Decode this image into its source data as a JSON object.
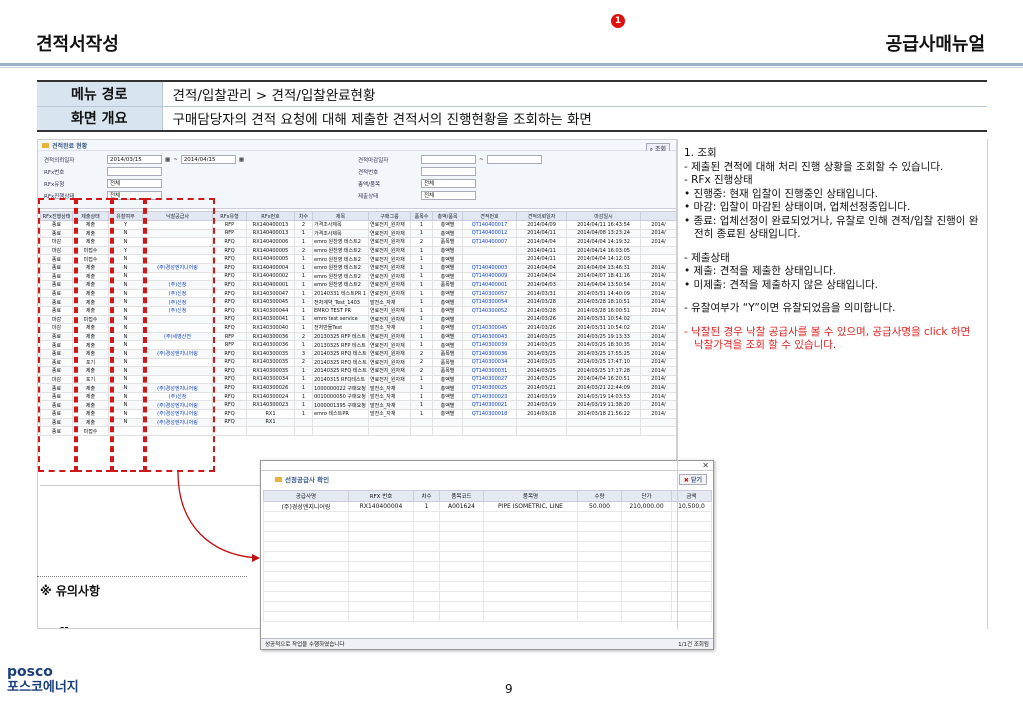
{
  "header": {
    "title_left": "견적서작성",
    "title_right": "공급사매뉴얼"
  },
  "info": [
    {
      "key": "메뉴 경로",
      "value": "견적/입찰관리 > 견적/입찰완료현황"
    },
    {
      "key": "화면 개요",
      "value": "구매담당자의 견적 요청에 대해 제출한 견적서의 진행현황을 조회하는 화면"
    }
  ],
  "screen": {
    "title": "견적완료 현황",
    "search_button": "조회",
    "badge": "1",
    "fields": {
      "f1_label": "견적의뢰일자",
      "f1_from": "2014/03/15",
      "f1_to": "2014/04/15",
      "f2_label": "RFx번호",
      "f3_label": "RFx유형",
      "f3_value": "전체",
      "f4_label": "RFx진행상태",
      "f4_value": "전체",
      "f5_label": "견적마감일자",
      "f6_label": "견적번호",
      "f7_label": "총액/품목",
      "f7_value": "전체",
      "f8_label": "제출상태",
      "f8_value": "전체"
    },
    "columns": [
      "RFx진행상태",
      "제출상태",
      "유찰여부",
      "낙찰공급사",
      "RFx유형",
      "RFx번호",
      "차수",
      "제목",
      "구매그룹",
      "품목수",
      "총액/품목",
      "견적번호",
      "견적의뢰일자",
      "마감일시",
      ""
    ],
    "rows": [
      [
        "종료",
        "제출",
        "Y",
        "",
        "RFP",
        "RX140400013",
        "2",
        "가격조사제목",
        "연료전지_원자재",
        "1",
        "총액별",
        "QT140400017",
        "2014/04/09",
        "2014/04/11 16:43:54",
        "2014/"
      ],
      [
        "종료",
        "제출",
        "N",
        "",
        "RFP",
        "RX140400013",
        "1",
        "가격조사제목",
        "연료전지_원자재",
        "1",
        "총액별",
        "QT140400012",
        "2014/04/11",
        "2014/04/08 13:23:24",
        "2014/"
      ],
      [
        "마감",
        "제출",
        "N",
        "",
        "RFQ",
        "RX140400006",
        "1",
        "emro 원찬영 테스트2",
        "연료전지_원자재",
        "2",
        "품목별",
        "QT140400007",
        "2014/04/04",
        "2014/04/04 14:19:32",
        "2014/"
      ],
      [
        "마감",
        "미접수",
        "Y",
        "",
        "RFQ",
        "RX140400005",
        "2",
        "emro 원찬영 테스트2",
        "연료전지_원자재",
        "1",
        "총액별",
        "",
        "2014/04/11",
        "2014/04/14 16:03:05",
        ""
      ],
      [
        "종료",
        "미접수",
        "N",
        "",
        "RFQ",
        "RX140400005",
        "1",
        "emro 원찬영 테스트2",
        "연료전지_원자재",
        "1",
        "총액별",
        "",
        "2014/04/11",
        "2014/04/04 14:12:03",
        ""
      ],
      [
        "종료",
        "제출",
        "N",
        "(주)경성엔지니어링",
        "RFQ",
        "RX140400004",
        "1",
        "emro 원찬영 테스트2",
        "연료전지_원자재",
        "1",
        "총액별",
        "QT140400003",
        "2014/04/04",
        "2014/04/04 13:46:31",
        "2014/"
      ],
      [
        "종료",
        "제출",
        "N",
        "",
        "RFQ",
        "RX140400002",
        "1",
        "emro 원찬영 테스트2",
        "연료전지_원자재",
        "1",
        "총액별",
        "QT140400009",
        "2014/04/04",
        "2014/04/07 18:41:16",
        "2014/"
      ],
      [
        "종료",
        "제출",
        "N",
        "(주)신정",
        "RFQ",
        "RX140400001",
        "1",
        "emro 원찬영 테스트2",
        "연료전지_원자재",
        "1",
        "품목별",
        "QT140400001",
        "2014/04/03",
        "2014/04/04 13:50:54",
        "2014/"
      ],
      [
        "종료",
        "제출",
        "N",
        "(주)신정",
        "RFQ",
        "RX140300047",
        "1",
        "20140331 테스트PR 1",
        "연료전지_원자재",
        "1",
        "총액별",
        "QT140300057",
        "2014/03/31",
        "2014/03/31 14:40:09",
        "2014/"
      ],
      [
        "종료",
        "제출",
        "N",
        "(주)신정",
        "RFQ",
        "RX140300045",
        "1",
        "전처계약_Test_1403",
        "발전소_자재",
        "1",
        "총액별",
        "QT140300054",
        "2014/03/28",
        "2014/03/28 18:10:51",
        "2014/"
      ],
      [
        "종료",
        "제출",
        "N",
        "(주)신정",
        "RFQ",
        "RX140300044",
        "1",
        "EMRO TEST PR",
        "연료전지_원자재",
        "1",
        "총액별",
        "QT140300052",
        "2014/03/28",
        "2014/03/28 16:00:51",
        "2014/"
      ],
      [
        "마감",
        "미접수",
        "N",
        "",
        "RFQ",
        "RX140300041",
        "1",
        "emro test service",
        "연료전지_원자재",
        "1",
        "총액별",
        "",
        "2014/03/26",
        "2014/03/31 10:54:02",
        ""
      ],
      [
        "마감",
        "제출",
        "N",
        "",
        "RFQ",
        "RX140300040",
        "1",
        "전처만들Test",
        "발전소_자재",
        "1",
        "총액별",
        "QT140300045",
        "2014/03/26",
        "2014/03/31 10:54:02",
        "2014/"
      ],
      [
        "종료",
        "제출",
        "N",
        "(주)세영산전",
        "RFP",
        "RX140300036",
        "2",
        "20130325 RFP 테스트",
        "연료전지_원자재",
        "1",
        "총액별",
        "QT140300043",
        "2014/03/25",
        "2014/03/25 19:13:33",
        "2014/"
      ],
      [
        "종료",
        "제출",
        "N",
        "",
        "RFP",
        "RX140300036",
        "1",
        "20130325 RFP 테스트",
        "연료전지_원자재",
        "1",
        "총액별",
        "QT140300039",
        "2014/03/25",
        "2014/03/25 18:30:35",
        "2014/"
      ],
      [
        "종료",
        "제출",
        "N",
        "(주)경성엔지니어링",
        "RFQ",
        "RX140300035",
        "3",
        "20140325 RFQ 테스트",
        "연료전지_원자재",
        "2",
        "품목별",
        "QT140300036",
        "2014/03/25",
        "2014/03/25 17:55:25",
        "2014/"
      ],
      [
        "종료",
        "포기",
        "N",
        "",
        "RFQ",
        "RX140300035",
        "2",
        "20140325 RFQ 테스트",
        "연료전지_원자재",
        "2",
        "품목별",
        "QT140300034",
        "2014/03/25",
        "2014/03/25 17:47:10",
        "2014/"
      ],
      [
        "종료",
        "제출",
        "N",
        "",
        "RFQ",
        "RX140300035",
        "1",
        "20140325 RFQ 테스트",
        "연료전지_원자재",
        "2",
        "품목별",
        "QT140300031",
        "2014/03/25",
        "2014/03/25 17:17:28",
        "2014/"
      ],
      [
        "마감",
        "포기",
        "N",
        "",
        "RFQ",
        "RX140300034",
        "1",
        "20140315 RFQ테스트",
        "연료전지_원자재",
        "1",
        "총액별",
        "QT140300027",
        "2014/03/25",
        "2014/04/04 16:20:51",
        "2014/"
      ],
      [
        "종료",
        "제출",
        "N",
        "(주)경성엔지니어링",
        "RFQ",
        "RX140300026",
        "1",
        "1000000022 구매요청",
        "발전소_자재",
        "1",
        "총액별",
        "QT140300025",
        "2014/03/21",
        "2014/03/21 22:44:09",
        "2014/"
      ],
      [
        "종료",
        "제출",
        "N",
        "(주)신정",
        "RFQ",
        "RX140300024",
        "1",
        "0010000050 구매요청",
        "발전소_자재",
        "1",
        "총액별",
        "QT140300023",
        "2014/03/19",
        "2014/03/19 14:03:53",
        "2014/"
      ],
      [
        "종료",
        "제출",
        "N",
        "(주)경성엔지니어링",
        "RFQ",
        "RX140300023",
        "1",
        "1000001395 구매요청",
        "발전소_자재",
        "1",
        "총액별",
        "QT140300021",
        "2014/03/19",
        "2014/03/19 11:38:20",
        "2014/"
      ],
      [
        "종료",
        "제출",
        "N",
        "(주)경성엔지니어링",
        "RFQ",
        "RX1",
        "1",
        "emro 테스트PR",
        "발전소_자재",
        "1",
        "총액별",
        "QT140300018",
        "2014/03/18",
        "2014/03/18 21:56:22",
        "2014/"
      ],
      [
        "종료",
        "제출",
        "N",
        "(주)경성엔지니어링",
        "RFQ",
        "RX1",
        "",
        "",
        "",
        "",
        "",
        "",
        "",
        "",
        ""
      ],
      [
        "종료",
        "미접수",
        "",
        "",
        "",
        "",
        "",
        "",
        "",
        "",
        "",
        "",
        "",
        "",
        ""
      ]
    ]
  },
  "popup": {
    "title": "선정공급사 확인",
    "close_label": "닫기",
    "columns": [
      "공급사명",
      "RFX 번호",
      "차수",
      "품목코드",
      "품목명",
      "수량",
      "단가",
      "금액"
    ],
    "rows": [
      [
        "(주)경성엔지니어링",
        "RX140400004",
        "1",
        "A001624",
        "PIPE ISOMETRIC, LINE",
        "50.000",
        "210,000.00",
        "10,500,0"
      ]
    ],
    "status": "성공적으로 작업을 수행하였습니다",
    "count": "1/1건 조회됨"
  },
  "notes": {
    "title": "※ 유의사항",
    "body": "--"
  },
  "description": [
    {
      "text": "1. 조회",
      "cls": ""
    },
    {
      "text": "- 제출된 견적에 대해 처리 진행 상황을 조회할 수 있습니다.",
      "cls": "ind"
    },
    {
      "text": "- RFx 진행상태",
      "cls": "ind"
    },
    {
      "text": "• 진행중: 현재 입찰이 진행중인 상태입니다.",
      "cls": "ind"
    },
    {
      "text": "• 마감: 입찰이 마감된 상태이며, 업체선정중입니다.",
      "cls": "ind"
    },
    {
      "text": "• 종료: 업체선정이 완료되었거나, 유찰로 인해 견적/입찰 진행이 완전히 종료된 상태입니다.",
      "cls": "ind"
    },
    {
      "text": "",
      "cls": ""
    },
    {
      "text": "- 제출상태",
      "cls": "ind"
    },
    {
      "text": "• 제출: 견적을 제출한 상태입니다.",
      "cls": "ind"
    },
    {
      "text": "• 미제출: 견적을 제출하지 않은 상태입니다.",
      "cls": "ind"
    },
    {
      "text": "",
      "cls": ""
    },
    {
      "text": "- 유찰여부가 “Y”이면 유찰되었음을 의미합니다.",
      "cls": "ind"
    },
    {
      "text": "",
      "cls": ""
    },
    {
      "text": "- 낙찰된 경우 낙찰 공급사를 볼 수 있으며, 공급사명을 click 하면 낙찰가격을 조회 할 수 있습니다.",
      "cls": "ind red"
    }
  ],
  "footer": {
    "logo": "posco",
    "logo_sub": "포스코에너지",
    "page": "9"
  }
}
